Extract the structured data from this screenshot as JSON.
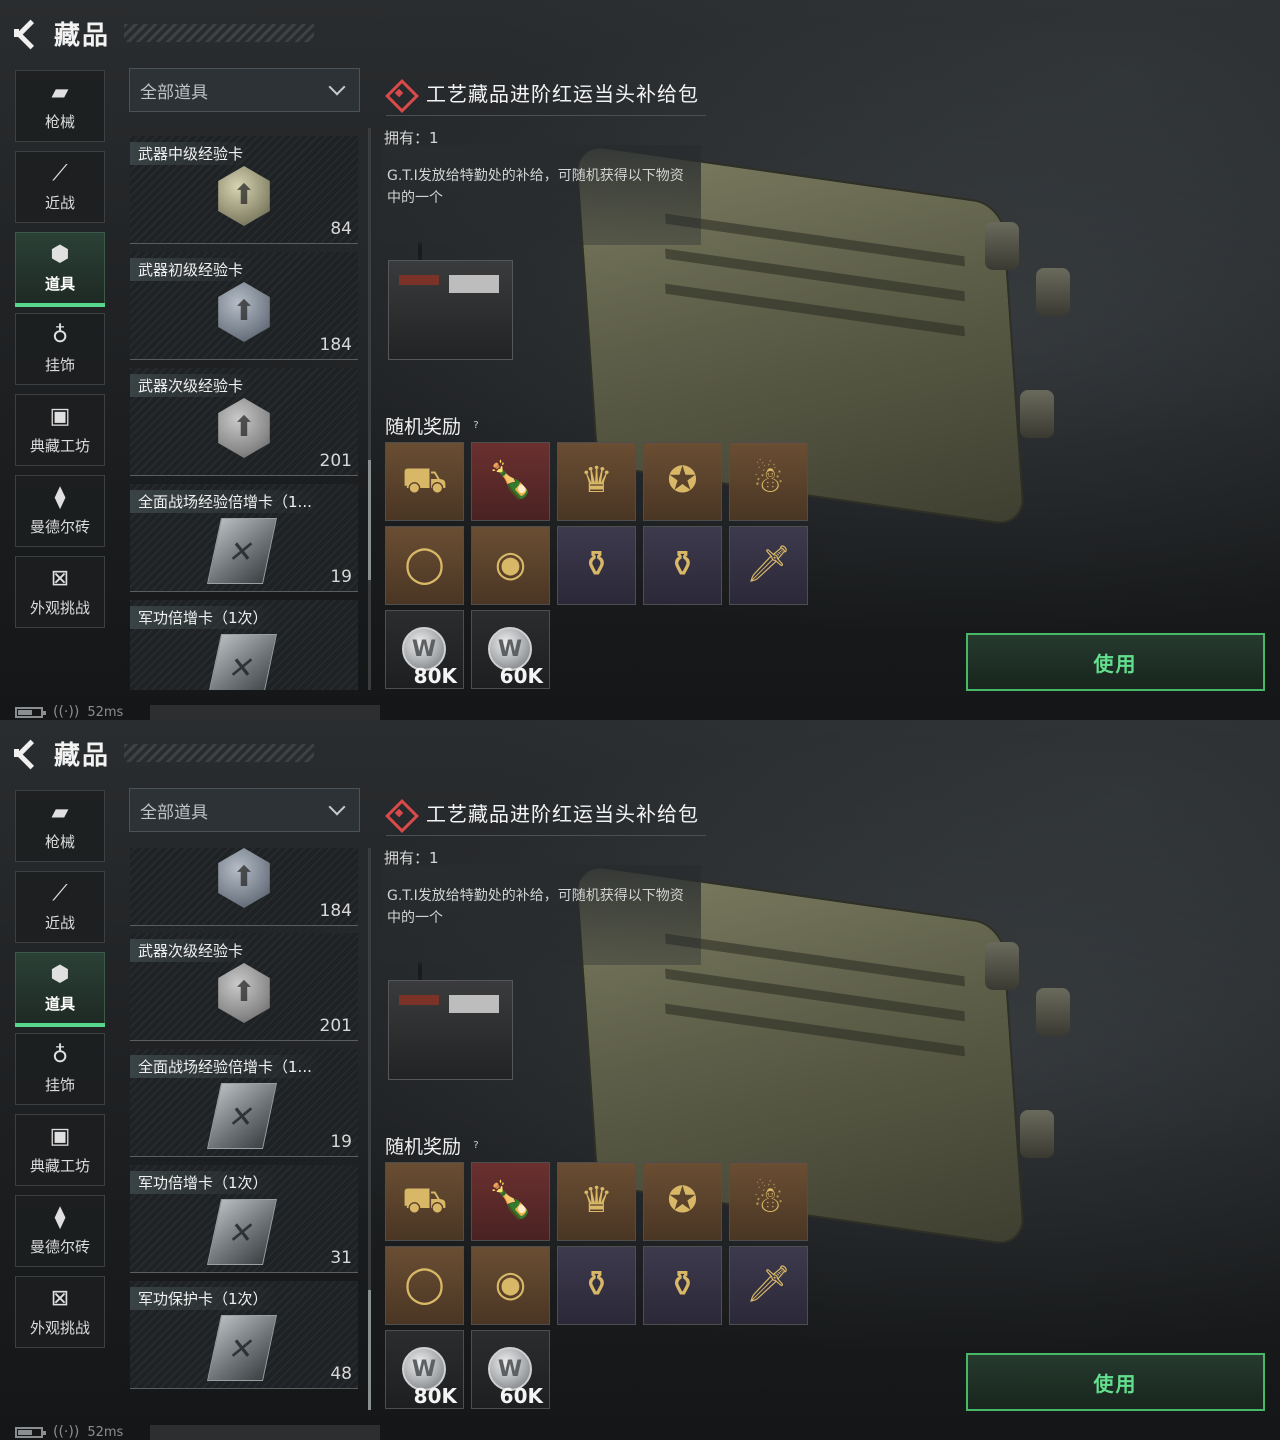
{
  "screens": [
    {
      "header": {
        "title": "藏品"
      },
      "sidebar": [
        {
          "label": "枪械",
          "icon": "pistol-icon",
          "glyph": "▰",
          "active": false
        },
        {
          "label": "近战",
          "icon": "knife-icon",
          "glyph": "⟋",
          "active": false
        },
        {
          "label": "道具",
          "icon": "cubes-icon",
          "glyph": "⬢",
          "active": true
        },
        {
          "label": "挂饰",
          "icon": "charm-icon",
          "glyph": "♁",
          "active": false
        },
        {
          "label": "典藏工坊",
          "icon": "workshop-icon",
          "glyph": "▣",
          "active": false
        },
        {
          "label": "曼德尔砖",
          "icon": "brick-icon",
          "glyph": "⧫",
          "active": false
        },
        {
          "label": "外观挑战",
          "icon": "challenge-icon",
          "glyph": "⊠",
          "active": false
        }
      ],
      "filter": {
        "value": "全部道具"
      },
      "list_scroll_fraction": 0.75,
      "items": [
        {
          "name": "武器中级经验卡",
          "count": "84",
          "icon": "hex-gold"
        },
        {
          "name": "武器初级经验卡",
          "count": "184",
          "icon": "hex-silver"
        },
        {
          "name": "武器次级经验卡",
          "count": "201",
          "icon": "hex-gray"
        },
        {
          "name": "全面战场经验倍增卡（1...",
          "count": "19",
          "icon": "card"
        },
        {
          "name": "军功倍增卡（1次）",
          "count": "",
          "icon": "card"
        }
      ],
      "detail": {
        "title": "工艺藏品进阶红运当头补给包",
        "owned": "拥有：1",
        "description": "G.T.I发放给特勤处的补给，可随机获得以下物资中的一个"
      },
      "rewards_title": "随机奖励",
      "rewards": [
        {
          "icon": "tank-icon",
          "glyph": "⛟",
          "rarity": "r-gold",
          "amount": ""
        },
        {
          "icon": "bottle-icon",
          "glyph": "🍾",
          "rarity": "r-red",
          "amount": ""
        },
        {
          "icon": "tiara-icon",
          "glyph": "♛",
          "rarity": "r-gold",
          "amount": ""
        },
        {
          "icon": "medal-icon",
          "glyph": "✪",
          "rarity": "r-gold",
          "amount": ""
        },
        {
          "icon": "figurine-icon",
          "glyph": "☃",
          "rarity": "r-gold",
          "amount": ""
        },
        {
          "icon": "bracelet-icon",
          "glyph": "◯",
          "rarity": "r-gold",
          "amount": ""
        },
        {
          "icon": "pocket-watch-icon",
          "glyph": "◉",
          "rarity": "r-gold",
          "amount": ""
        },
        {
          "icon": "vase-icon",
          "glyph": "⚱",
          "rarity": "r-purple",
          "amount": ""
        },
        {
          "icon": "teapot-icon",
          "glyph": "⚱",
          "rarity": "r-purple",
          "amount": ""
        },
        {
          "icon": "dagger-icon",
          "glyph": "🗡",
          "rarity": "r-purple",
          "amount": ""
        },
        {
          "icon": "coin-icon",
          "glyph": "",
          "rarity": "r-dark",
          "amount": "80K"
        },
        {
          "icon": "coin-icon",
          "glyph": "",
          "rarity": "r-dark",
          "amount": "60K"
        }
      ],
      "use_button": "使用",
      "status": {
        "ping": "52ms"
      }
    },
    {
      "header": {
        "title": "藏品"
      },
      "sidebar": [
        {
          "label": "枪械",
          "icon": "pistol-icon",
          "glyph": "▰",
          "active": false
        },
        {
          "label": "近战",
          "icon": "knife-icon",
          "glyph": "⟋",
          "active": false
        },
        {
          "label": "道具",
          "icon": "cubes-icon",
          "glyph": "⬢",
          "active": true
        },
        {
          "label": "挂饰",
          "icon": "charm-icon",
          "glyph": "♁",
          "active": false
        },
        {
          "label": "典藏工坊",
          "icon": "workshop-icon",
          "glyph": "▣",
          "active": false
        },
        {
          "label": "曼德尔砖",
          "icon": "brick-icon",
          "glyph": "⧫",
          "active": false
        },
        {
          "label": "外观挑战",
          "icon": "challenge-icon",
          "glyph": "⊠",
          "active": false
        }
      ],
      "filter": {
        "value": "全部道具"
      },
      "list_scroll_fraction": 1.0,
      "items": [
        {
          "name": "",
          "count": "184",
          "icon": "hex-silver"
        },
        {
          "name": "武器次级经验卡",
          "count": "201",
          "icon": "hex-gray"
        },
        {
          "name": "全面战场经验倍增卡（1...",
          "count": "19",
          "icon": "card"
        },
        {
          "name": "军功倍增卡（1次）",
          "count": "31",
          "icon": "card"
        },
        {
          "name": "军功保护卡（1次）",
          "count": "48",
          "icon": "card"
        }
      ],
      "detail": {
        "title": "工艺藏品进阶红运当头补给包",
        "owned": "拥有：1",
        "description": "G.T.I发放给特勤处的补给，可随机获得以下物资中的一个"
      },
      "rewards_title": "随机奖励",
      "rewards": [
        {
          "icon": "tank-icon",
          "glyph": "⛟",
          "rarity": "r-gold",
          "amount": ""
        },
        {
          "icon": "bottle-icon",
          "glyph": "🍾",
          "rarity": "r-red",
          "amount": ""
        },
        {
          "icon": "tiara-icon",
          "glyph": "♛",
          "rarity": "r-gold",
          "amount": ""
        },
        {
          "icon": "medal-icon",
          "glyph": "✪",
          "rarity": "r-gold",
          "amount": ""
        },
        {
          "icon": "figurine-icon",
          "glyph": "☃",
          "rarity": "r-gold",
          "amount": ""
        },
        {
          "icon": "bracelet-icon",
          "glyph": "◯",
          "rarity": "r-gold",
          "amount": ""
        },
        {
          "icon": "pocket-watch-icon",
          "glyph": "◉",
          "rarity": "r-gold",
          "amount": ""
        },
        {
          "icon": "vase-icon",
          "glyph": "⚱",
          "rarity": "r-purple",
          "amount": ""
        },
        {
          "icon": "teapot-icon",
          "glyph": "⚱",
          "rarity": "r-purple",
          "amount": ""
        },
        {
          "icon": "dagger-icon",
          "glyph": "🗡",
          "rarity": "r-purple",
          "amount": ""
        },
        {
          "icon": "coin-icon",
          "glyph": "",
          "rarity": "r-dark",
          "amount": "80K"
        },
        {
          "icon": "coin-icon",
          "glyph": "",
          "rarity": "r-dark",
          "amount": "60K"
        }
      ],
      "use_button": "使用",
      "status": {
        "ping": "52ms"
      }
    }
  ],
  "colors": {
    "accent": "#58d68d",
    "diamond": "#d94a4a",
    "background": "#1c1e20"
  }
}
